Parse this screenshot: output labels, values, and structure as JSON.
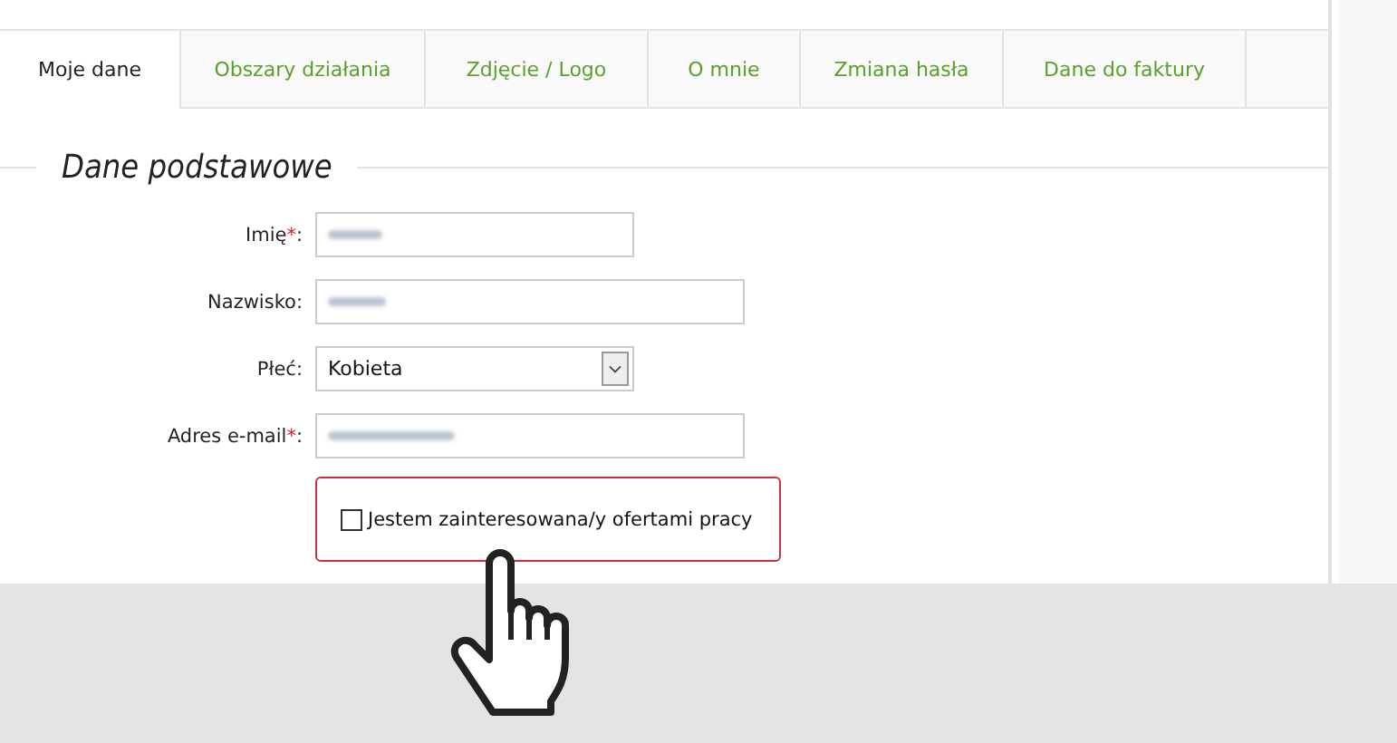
{
  "tabs": [
    {
      "label": "Moje dane",
      "selected": true
    },
    {
      "label": "Obszary działania",
      "selected": false
    },
    {
      "label": "Zdjęcie / Logo",
      "selected": false
    },
    {
      "label": "O mnie",
      "selected": false
    },
    {
      "label": "Zmiana hasła",
      "selected": false
    },
    {
      "label": "Dane do faktury",
      "selected": false
    }
  ],
  "section": {
    "title": "Dane podstawowe"
  },
  "fields": [
    {
      "kind": "text",
      "label": "Imię",
      "marker": "*",
      "suffix": ":",
      "blurred": true
    },
    {
      "kind": "text",
      "label": "Nazwisko:",
      "blurred": true
    },
    {
      "kind": "select",
      "label": "Płeć:",
      "value": "Kobieta"
    },
    {
      "kind": "text",
      "label": "Adres e-mail",
      "marker": "*",
      "suffix": ":",
      "blurred": true
    }
  ],
  "offer_checkbox": {
    "label": "Jestem zainteresowana/y ofertami pracy",
    "checked": false
  }
}
